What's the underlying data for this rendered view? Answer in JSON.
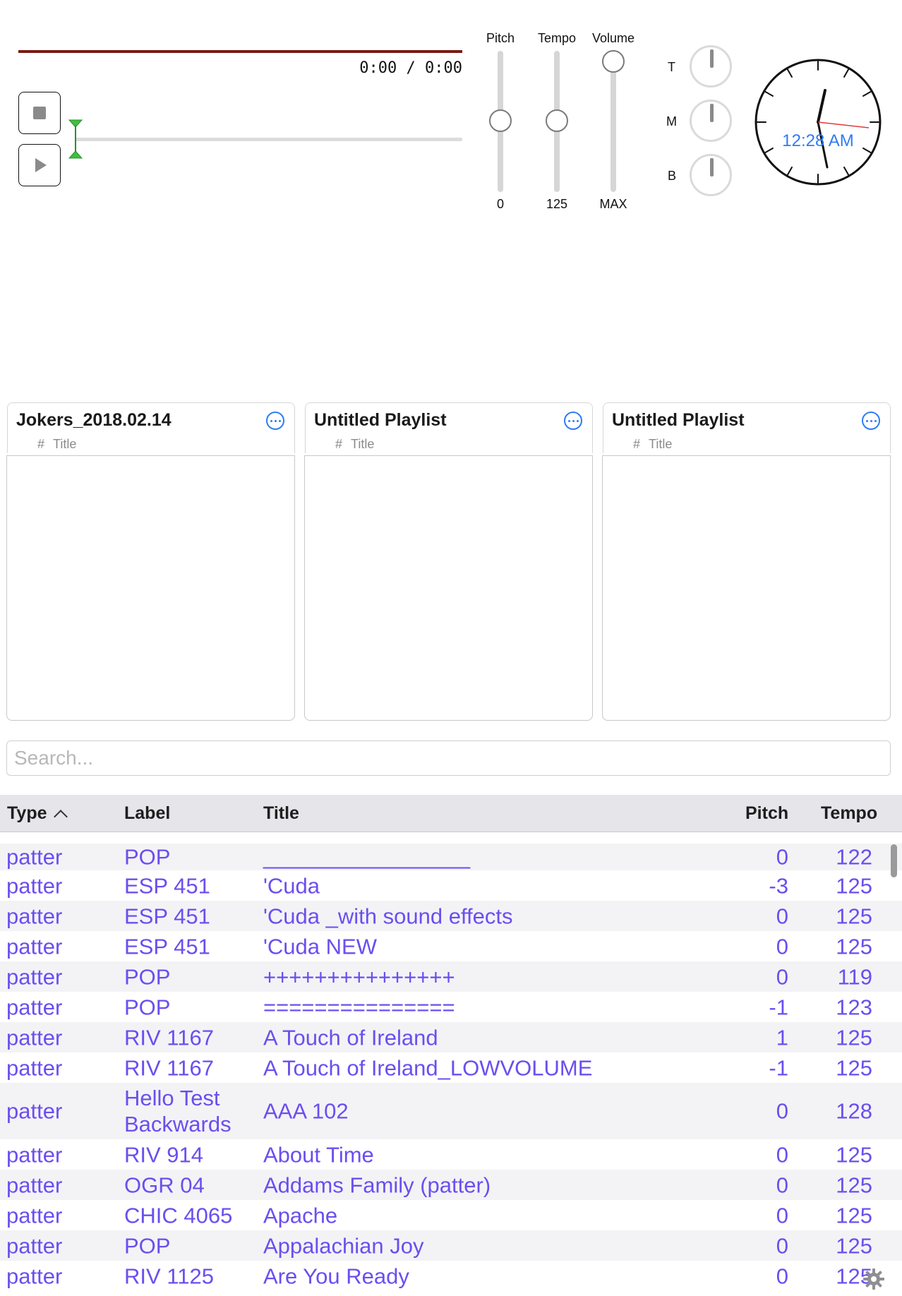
{
  "player": {
    "time": "0:00 / 0:00",
    "progress_color": "#7a1a12"
  },
  "sliders": {
    "pitch": {
      "label": "Pitch",
      "value": "0",
      "position": 0.5
    },
    "tempo": {
      "label": "Tempo",
      "value": "125",
      "position": 0.5
    },
    "volume": {
      "label": "Volume",
      "value": "MAX",
      "position": 1.0
    }
  },
  "eq": {
    "t": "T",
    "m": "M",
    "b": "B"
  },
  "clock": {
    "time": "12:28 AM",
    "accent": "#2d7cf6"
  },
  "playlists": [
    {
      "title": "Jokers_2018.02.14",
      "col_num": "#",
      "col_title": "Title"
    },
    {
      "title": "Untitled Playlist",
      "col_num": "#",
      "col_title": "Title"
    },
    {
      "title": "Untitled Playlist",
      "col_num": "#",
      "col_title": "Title"
    }
  ],
  "search": {
    "placeholder": "Search..."
  },
  "table": {
    "headers": {
      "type": "Type",
      "label": "Label",
      "title": "Title",
      "pitch": "Pitch",
      "tempo": "Tempo"
    },
    "rows": [
      {
        "type": "patter",
        "label": "POP",
        "title": "_________________",
        "pitch": "0",
        "tempo": "122"
      },
      {
        "type": "patter",
        "label": "ESP 451",
        "title": "'Cuda",
        "pitch": "-3",
        "tempo": "125"
      },
      {
        "type": "patter",
        "label": "ESP 451",
        "title": "'Cuda _with sound effects",
        "pitch": "0",
        "tempo": "125"
      },
      {
        "type": "patter",
        "label": "ESP 451",
        "title": "'Cuda NEW",
        "pitch": "0",
        "tempo": "125"
      },
      {
        "type": "patter",
        "label": "POP",
        "title": "+++++++++++++++",
        "pitch": "0",
        "tempo": "119"
      },
      {
        "type": "patter",
        "label": "POP",
        "title": "===============",
        "pitch": "-1",
        "tempo": "123"
      },
      {
        "type": "patter",
        "label": "RIV 1167",
        "title": "A Touch of Ireland",
        "pitch": "1",
        "tempo": "125"
      },
      {
        "type": "patter",
        "label": "RIV 1167",
        "title": "A Touch of Ireland_LOWVOLUME",
        "pitch": "-1",
        "tempo": "125"
      },
      {
        "type": "patter",
        "label": "Hello Test Backwards",
        "title": "AAA 102",
        "pitch": "0",
        "tempo": "128"
      },
      {
        "type": "patter",
        "label": "RIV 914",
        "title": "About Time",
        "pitch": "0",
        "tempo": "125"
      },
      {
        "type": "patter",
        "label": "OGR 04",
        "title": "Addams Family (patter)",
        "pitch": "0",
        "tempo": "125"
      },
      {
        "type": "patter",
        "label": "CHIC 4065",
        "title": "Apache",
        "pitch": "0",
        "tempo": "125"
      },
      {
        "type": "patter",
        "label": "POP",
        "title": "Appalachian Joy",
        "pitch": "0",
        "tempo": "125"
      },
      {
        "type": "patter",
        "label": "RIV 1125",
        "title": "Are You Ready",
        "pitch": "0",
        "tempo": "125"
      }
    ]
  },
  "colors": {
    "row_text": "#6b4ef0",
    "header_bg": "#e5e5ea",
    "seek_handle": "#3fbf3f"
  }
}
